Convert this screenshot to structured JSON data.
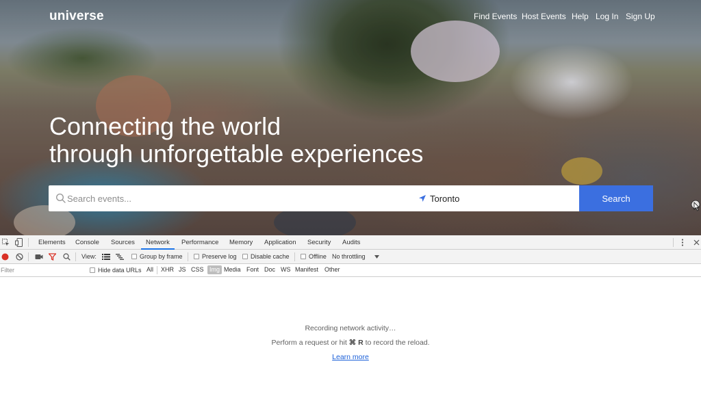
{
  "site": {
    "logo": "universe",
    "nav": [
      "Find Events",
      "Host Events",
      "Help",
      "Log In",
      "Sign Up"
    ],
    "headline": [
      "Connecting the world",
      "through unforgettable experiences"
    ],
    "search": {
      "placeholder": "Search events...",
      "location": "Toronto",
      "button": "Search"
    },
    "colors": {
      "accent": "#3b6fe0"
    }
  },
  "devtools": {
    "tabs": [
      "Elements",
      "Console",
      "Sources",
      "Network",
      "Performance",
      "Memory",
      "Application",
      "Security",
      "Audits"
    ],
    "active_tab": "Network",
    "toolbar": {
      "view_label": "View:",
      "group_by_frame": "Group by frame",
      "preserve_log": "Preserve log",
      "disable_cache": "Disable cache",
      "offline": "Offline",
      "throttling": "No throttling"
    },
    "filterbar": {
      "filter_placeholder": "Filter",
      "hide_data_urls": "Hide data URLs",
      "types": [
        "All",
        "XHR",
        "JS",
        "CSS",
        "Img",
        "Media",
        "Font",
        "Doc",
        "WS",
        "Manifest",
        "Other"
      ],
      "active_type": "Img"
    },
    "empty": {
      "recording": "Recording network activity…",
      "hint_prefix": "Perform a request or hit",
      "hint_keys": "⌘ R",
      "hint_suffix": "to record the reload.",
      "learn_more": "Learn more"
    },
    "colors": {
      "record": "#d93025",
      "filter_icon": "#d93025",
      "active_tab_underline": "#1a73e8"
    }
  }
}
